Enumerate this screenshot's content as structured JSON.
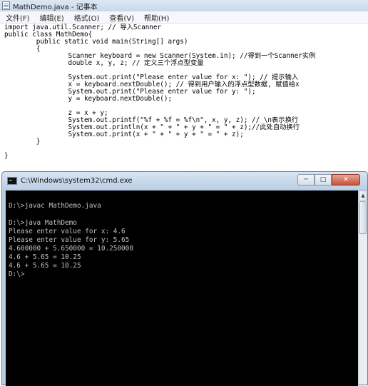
{
  "notepad": {
    "title": "MathDemo.java - 记事本",
    "menu": [
      {
        "label": "文件(F)"
      },
      {
        "label": "编辑(E)"
      },
      {
        "label": "格式(O)"
      },
      {
        "label": "查看(V)"
      },
      {
        "label": "帮助(H)"
      }
    ],
    "code_lines": [
      "import java.util.Scanner; // 导入Scanner",
      "public class MathDemo{",
      "        public static void main(String[] args)",
      "        {",
      "                Scanner keyboard = new Scanner(System.in); //得到一个Scanner实例",
      "                double x, y, z; // 定义三个浮点型变量",
      "",
      "                System.out.print(\"Please enter value for x: \"); // 提示输入",
      "                x = keyboard.nextDouble(); // 得到用户输入的浮点型数据, 赋值给x",
      "                System.out.print(\"Please enter value for y: \");",
      "                y = keyboard.nextDouble();",
      "",
      "                z = x + y;",
      "                System.out.printf(\"%f + %f = %f\\n\", x, y, z); // \\n表示换行",
      "                System.out.println(x + \" + \" + y + \" = \" + z);//此处自动换行",
      "                System.out.print(x + \" + \" + y + \" = \" + z);",
      "        }",
      "",
      "}"
    ]
  },
  "cmd": {
    "title": "C:\\Windows\\system32\\cmd.exe",
    "buttons": {
      "minimize": "─",
      "maximize": "□",
      "close": "✕"
    },
    "scroll_up": "▲",
    "lines": [
      "",
      "D:\\>javac MathDemo.java",
      "",
      "D:\\>java MathDemo",
      "Please enter value for x: 4.6",
      "Please enter value for y: 5.65",
      "4.600000 + 5.650000 = 10.250000",
      "4.6 + 5.65 = 10.25",
      "4.6 + 5.65 = 10.25",
      "D:\\>"
    ]
  },
  "colors": {
    "console_bg": "#000000",
    "console_text": "#c0c0c0",
    "editor_bg": "#ffffff"
  }
}
